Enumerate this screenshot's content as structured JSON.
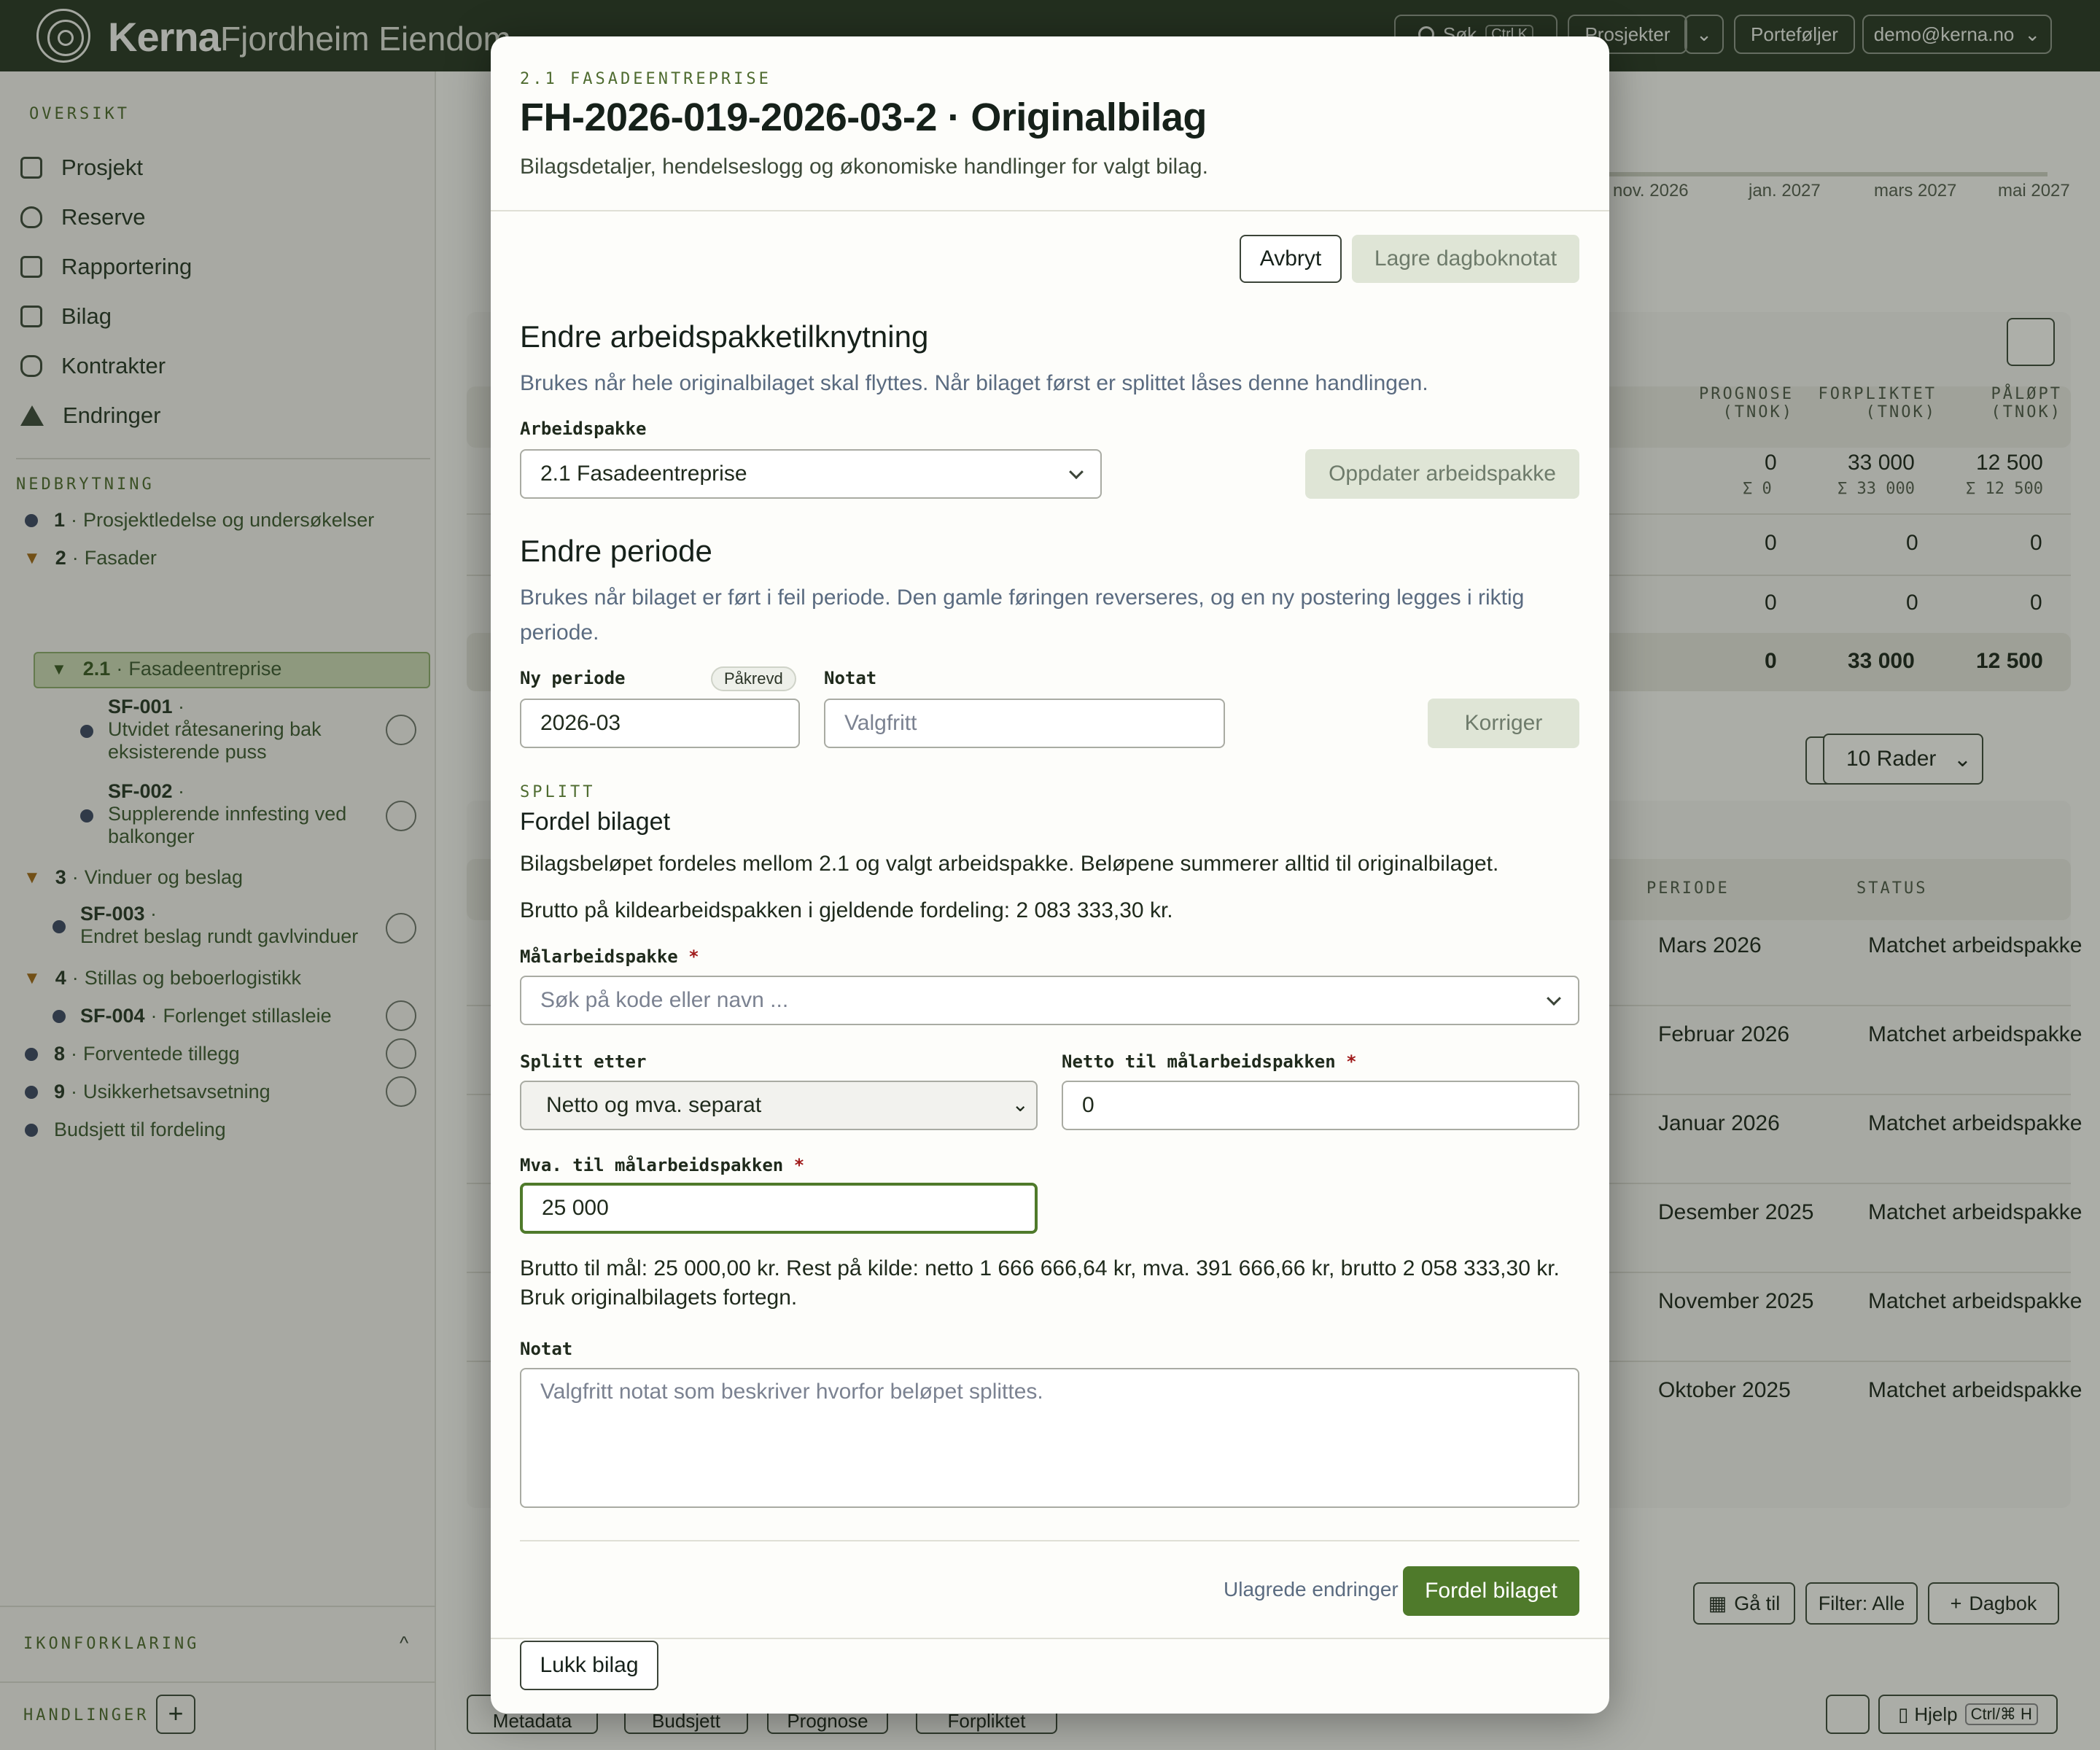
{
  "topbar": {
    "brand": "Kerna",
    "org": "Fjordheim Eiendom",
    "search_label": "Søk",
    "search_shortcut": "Ctrl K",
    "projects_label": "Prosjekter",
    "portfolios_label": "Porteføljer",
    "user_label": "demo@kerna.no"
  },
  "sidebar": {
    "overview_label": "OVERSIKT",
    "nav": [
      "Prosjekt",
      "Reserve",
      "Rapportering",
      "Bilag",
      "Kontrakter",
      "Endringer"
    ],
    "breakdown_label": "NEDBRYTNING",
    "tree": {
      "i1_code": "1",
      "i1_name": "Prosjektledelse og undersøkelser",
      "i2_code": "2",
      "i2_name": "Fasader",
      "i21_code": "2.1",
      "i21_name": "Fasadeentreprise",
      "sf001_code": "SF-001",
      "sf001_name_1": "Utvidet råtesanering bak",
      "sf001_name_2": "eksisterende puss",
      "sf002_code": "SF-002",
      "sf002_name_1": "Supplerende innfesting ved",
      "sf002_name_2": "balkonger",
      "i3_code": "3",
      "i3_name": "Vinduer og beslag",
      "sf003_code": "SF-003",
      "sf003_name": "Endret beslag rundt gavlvinduer",
      "i4_code": "4",
      "i4_name": "Stillas og beboerlogistikk",
      "sf004_code": "SF-004",
      "sf004_name": "Forlenget stillasleie",
      "i8_code": "8",
      "i8_name": "Forventede tillegg",
      "i9_code": "9",
      "i9_name": "Usikkerhetsavsetning",
      "budget_label": "Budsjett til fordeling"
    },
    "legend_label": "IKONFORKLARING",
    "actions_label": "HANDLINGER"
  },
  "background": {
    "timeline": [
      "nov. 2026",
      "jan. 2027",
      "mars 2027",
      "mai 2027"
    ],
    "col_prognose": "PROGNOSE",
    "col_forpliktet": "FORPLIKTET",
    "col_palopt": "PÅLØPT",
    "col_unit": "(TNOK)",
    "row1": [
      "0",
      "33 000",
      "12 500"
    ],
    "row1_sum": [
      "Σ 0",
      "Σ 33 000",
      "Σ 12 500"
    ],
    "row2": [
      "0",
      "0",
      "0"
    ],
    "row3": [
      "0",
      "0",
      "0"
    ],
    "total": [
      "0",
      "33 000",
      "12 500"
    ],
    "rows_select": "10 Rader",
    "col_periode": "PERIODE",
    "col_status": "STATUS",
    "bilag_rows": [
      {
        "period": "Mars 2026",
        "status": "Matchet arbeidspakke"
      },
      {
        "period": "Februar 2026",
        "status": "Matchet arbeidspakke"
      },
      {
        "period": "Januar 2026",
        "status": "Matchet arbeidspakke"
      },
      {
        "period": "Desember 2025",
        "status": "Matchet arbeidspakke"
      },
      {
        "period": "November 2025",
        "status": "Matchet arbeidspakke"
      },
      {
        "period": "Oktober 2025",
        "status": "Matchet arbeidspakke"
      }
    ],
    "goto_label": "Gå til",
    "filter_label": "Filter: Alle",
    "dagbok_label": "Dagbok",
    "bottom_tabs": [
      "Metadata",
      "Budsjett",
      "Prognose",
      "Forpliktet"
    ],
    "help_label": "Hjelp",
    "help_shortcut": "Ctrl/⌘ H"
  },
  "modal": {
    "eyebrow": "2.1 FASADEENTREPRISE",
    "title": "FH-2026-019-2026-03-2 · Originalbilag",
    "subtitle": "Bilagsdetaljer, hendelseslogg og økonomiske handlinger for valgt bilag.",
    "cancel_label": "Avbryt",
    "save_note_label": "Lagre dagboknotat",
    "change_wp": {
      "heading": "Endre arbeidspakketilknytning",
      "description": "Brukes når hele originalbilaget skal flyttes. Når bilaget først er splittet låses denne handlingen.",
      "field_label": "Arbeidspakke",
      "field_value": "2.1 Fasadeentreprise",
      "button": "Oppdater arbeidspakke"
    },
    "change_period": {
      "heading": "Endre periode",
      "description_1": "Brukes når bilaget er ført i feil periode. Den gamle føringen reverseres, og en ny postering legges i riktig",
      "description_2": "periode.",
      "period_label": "Ny periode",
      "required_badge": "Påkrevd",
      "period_value": "2026-03",
      "note_label": "Notat",
      "note_placeholder": "Valgfritt",
      "button": "Korriger"
    },
    "split": {
      "eyebrow": "SPLITT",
      "heading": "Fordel bilaget",
      "description": "Bilagsbeløpet fordeles mellom 2.1 og valgt arbeidspakke. Beløpene summerer alltid til originalbilaget.",
      "gross_info": "Brutto på kildearbeidspakken i gjeldende fordeling: 2 083 333,30 kr.",
      "target_label": "Målarbeidspakke",
      "target_placeholder": "Søk på kode eller navn ...",
      "split_by_label": "Splitt etter",
      "split_by_value": "Netto og mva. separat",
      "net_label": "Netto til målarbeidspakken",
      "net_value": "0",
      "vat_label": "Mva. til målarbeidspakken",
      "vat_value": "25 000",
      "summary_1": "Brutto til mål: 25 000,00 kr. Rest på kilde: netto 1 666 666,64 kr, mva. 391 666,66 kr, brutto 2 058 333,30 kr.",
      "summary_2": "Bruk originalbilagets fortegn.",
      "note_label": "Notat",
      "note_placeholder": "Valgfritt notat som beskriver hvorfor beløpet splittes.",
      "unsaved": "Ulagrede endringer",
      "button": "Fordel bilaget"
    },
    "close_label": "Lukk bilag"
  }
}
